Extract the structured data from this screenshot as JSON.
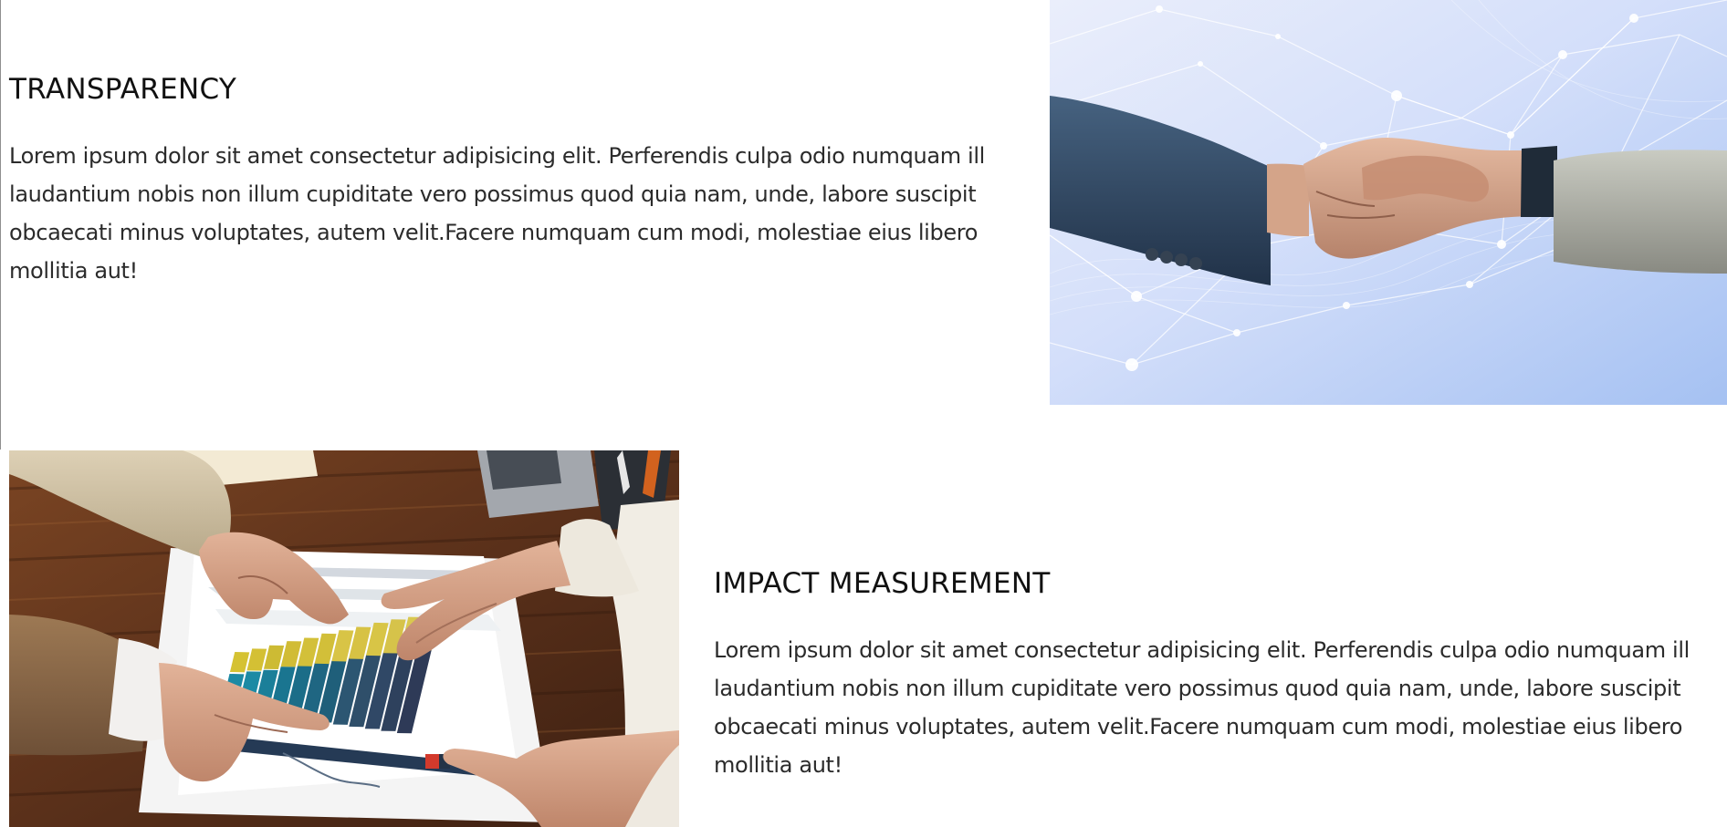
{
  "sections": [
    {
      "heading": "TRANSPARENCY",
      "text": "Lorem ipsum dolor sit amet consectetur adipisicing elit. Perferendis culpa odio numquam ill laudantium nobis non illum cupiditate vero possimus quod quia nam, unde, labore suscipit obcaecati minus voluptates, autem velit.Facere numquam cum modi, molestiae eius libero mollitia aut!"
    },
    {
      "heading": "IMPACT MEASUREMENT",
      "text": "Lorem ipsum dolor sit amet consectetur adipisicing elit. Perferendis culpa odio numquam ill laudantium nobis non illum cupiditate vero possimus quod quia nam, unde, labore suscipit obcaecati minus voluptates, autem velit.Facere numquam cum modi, molestiae eius libero mollitia aut!"
    }
  ],
  "colors": {
    "heading": "#111111",
    "body_text": "#2b2b2b",
    "background": "#ffffff",
    "network_tint": "#b7cdf7",
    "table_wood": "#5a3018",
    "chart_bar_yellow": "#d8c132",
    "chart_bar_teal": "#1a8aa5"
  },
  "images": [
    {
      "name": "handshake-photo"
    },
    {
      "name": "chart-review-photo"
    }
  ]
}
